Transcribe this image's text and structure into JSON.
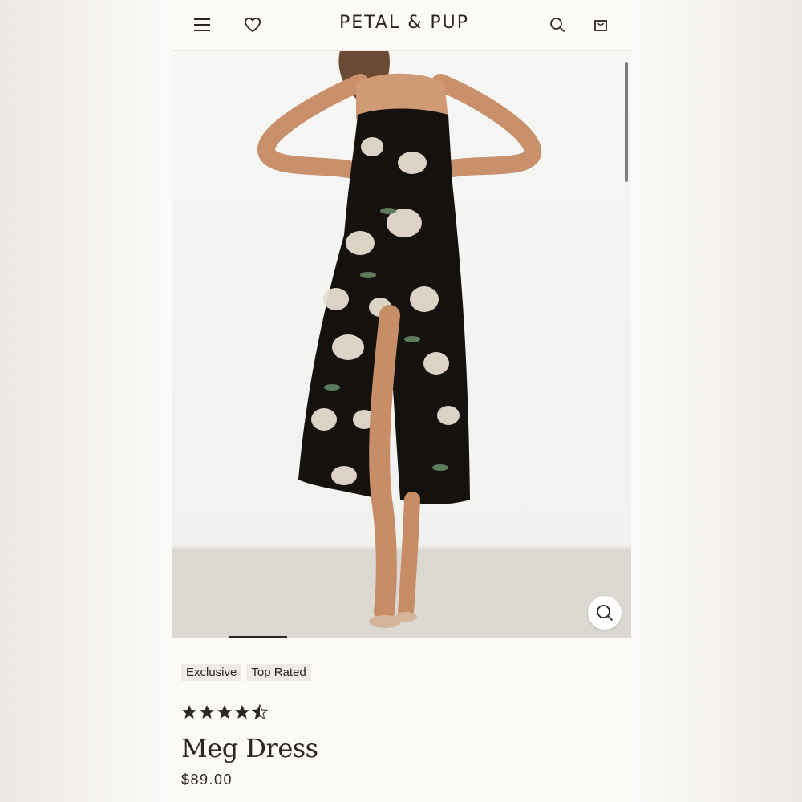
{
  "header": {
    "brand": "PETAL & PUP",
    "icons": [
      "menu-icon",
      "heart-icon",
      "search-icon",
      "bag-icon"
    ]
  },
  "gallery": {
    "image_alt": "Model wearing black floral midi dress with side split",
    "zoom_icon": "search-icon"
  },
  "product": {
    "badges": [
      "Exclusive",
      "Top Rated"
    ],
    "rating": 4.5,
    "rating_max": 5,
    "name": "Meg Dress",
    "price": "$89.00"
  },
  "colors": {
    "text": "#2b2523",
    "badge_bg": "#eeeae6",
    "dress": "#14110f"
  }
}
